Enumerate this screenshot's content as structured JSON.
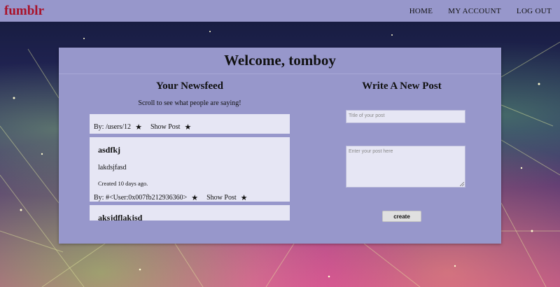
{
  "brand": "fumblr",
  "nav": [
    {
      "label": "HOME"
    },
    {
      "label": "MY ACCOUNT"
    },
    {
      "label": "LOG OUT"
    }
  ],
  "welcome": "Welcome, tomboy",
  "newsfeed": {
    "title": "Your Newsfeed",
    "subtitle": "Scroll to see what people are saying!",
    "posts": [
      {
        "title": "",
        "body": "",
        "created": "",
        "by_label": "By: /users/12",
        "show_label": "Show Post"
      },
      {
        "title": "asdfkj",
        "body": "lakdsjfasd",
        "created": "Created 10 days ago.",
        "by_label": "By: #<User:0x007fb212936360>",
        "show_label": "Show Post"
      },
      {
        "title": "aksjdflakjsd",
        "body": "",
        "created": "",
        "by_label": "",
        "show_label": ""
      }
    ]
  },
  "new_post": {
    "title": "Write A New Post",
    "title_placeholder": "Title of your post",
    "body_placeholder": "Enter your post here",
    "create_label": "create"
  },
  "icons": {
    "star": "star-icon",
    "resize": "resize-handle-icon"
  },
  "colors": {
    "bar": "#9797cb",
    "brand": "#a8122a",
    "post_bg": "#e6e6f4"
  }
}
